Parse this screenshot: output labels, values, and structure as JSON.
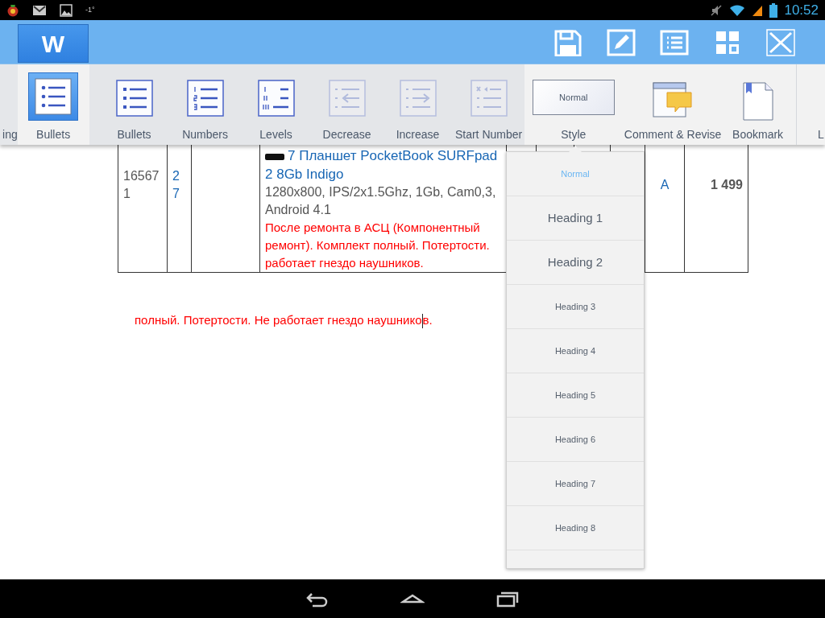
{
  "status_bar": {
    "temperature": "-1°",
    "time": "10:52"
  },
  "app_bar": {
    "logo": "W"
  },
  "ribbon": {
    "lead_item": {
      "label": "ing"
    },
    "tab_button": {
      "label": "Bullets",
      "selected": true
    },
    "submenu": [
      {
        "label": "Bullets",
        "kind": "bullets",
        "disabled": false
      },
      {
        "label": "Numbers",
        "kind": "numbers",
        "disabled": false
      },
      {
        "label": "Levels",
        "kind": "levels",
        "disabled": false
      },
      {
        "label": "Decrease",
        "kind": "decrease",
        "disabled": true
      },
      {
        "label": "Increase",
        "kind": "increase",
        "disabled": true
      },
      {
        "label": "Start Number",
        "kind": "start",
        "disabled": true
      }
    ],
    "items": [
      {
        "label": "Style",
        "kind": "style",
        "value": "Normal"
      },
      {
        "label": "Comment & Revise",
        "kind": "comment"
      },
      {
        "label": "Bookmark",
        "kind": "bookmark"
      }
    ],
    "trailing_item": {
      "label": "L"
    }
  },
  "table": {
    "rows": [
      {
        "column_1": "165671",
        "column_2": "27",
        "product": {
          "title_lines": [
            "7 Планшет PocketBook SURFpad",
            "2 8Gb Indigo"
          ],
          "spec_lines": [
            "1280x800, IPS/2x1.5Ghz, 1Gb, Cam0,3,",
            "Android 4.1"
          ],
          "note_lines": [
            "После ремонта в АСЦ (Компонентный",
            "ремонт). Комплект полный. Потертости.",
            "работает гнездо наушников."
          ]
        },
        "column_9": "A",
        "column_10": "1 499"
      }
    ]
  },
  "paragraph": {
    "text_before_cursor": "полный. Потертости. Не работает гнездо наушнико",
    "text_after_cursor": "в."
  },
  "style_menu": [
    {
      "label": "Normal",
      "kind": "minor",
      "selected": true
    },
    {
      "label": "Heading 1",
      "kind": "major",
      "selected": false
    },
    {
      "label": "Heading 2",
      "kind": "major",
      "selected": false
    },
    {
      "label": "Heading 3",
      "kind": "minor",
      "selected": false
    },
    {
      "label": "Heading 4",
      "kind": "minor",
      "selected": false
    },
    {
      "label": "Heading 5",
      "kind": "minor",
      "selected": false
    },
    {
      "label": "Heading 6",
      "kind": "minor",
      "selected": false
    },
    {
      "label": "Heading 7",
      "kind": "minor",
      "selected": false
    },
    {
      "label": "Heading 8",
      "kind": "minor",
      "selected": false
    }
  ]
}
